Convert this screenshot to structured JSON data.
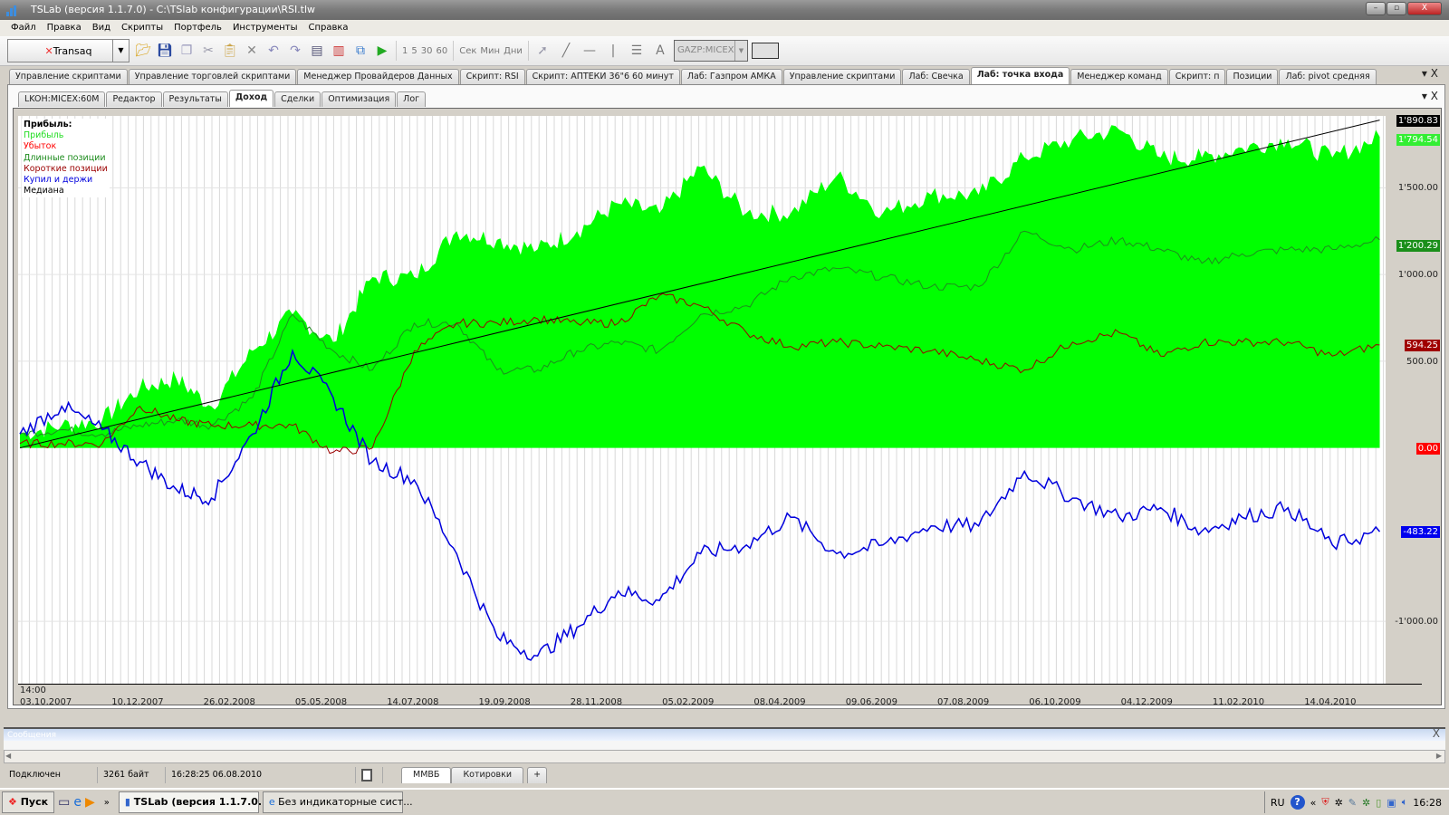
{
  "window": {
    "title": "TSLab (версия 1.1.7.0) - C:\\TSlab конфигурации\\RSI.tlw",
    "minimize": "–",
    "maximize": "▫",
    "close": "X"
  },
  "menu": [
    "Файл",
    "Правка",
    "Вид",
    "Скрипты",
    "Портфель",
    "Инструменты",
    "Справка"
  ],
  "toolbar": {
    "provider": "Transaq",
    "timeframes": [
      "1",
      "5",
      "30",
      "60"
    ],
    "units": [
      "Сек",
      "Мин",
      "Дни"
    ],
    "symbol": "GAZP:MICEX",
    "icons": [
      "open-folder-icon",
      "save-icon",
      "copy-icon",
      "cut-icon",
      "paste-icon",
      "delete-icon",
      "undo-icon",
      "redo-icon",
      "properties-icon",
      "chart-icon",
      "diagram-icon",
      "run-icon"
    ]
  },
  "main_tabs": [
    "Управление скриптами",
    "Управление торговлей скриптами",
    "Менеджер Провайдеров Данных",
    "Скрипт: RSI",
    "Скрипт: АПТЕКИ 36\"6 60 минут",
    "Лаб: Газпром АМКА",
    "Управление скриптами",
    "Лаб: Свечка",
    "Лаб: точка входа",
    "Менеджер команд",
    "Скрипт: п",
    "Позиции",
    "Лаб: pivot средняя"
  ],
  "main_tabs_active": 8,
  "sub_tabs": [
    "LKOH:MICEX:60M",
    "Редактор",
    "Результаты",
    "Доход",
    "Сделки",
    "Оптимизация",
    "Лог"
  ],
  "sub_tabs_active": 3,
  "tab_controls": {
    "menu": "▾",
    "close": "X"
  },
  "chart_data": {
    "type": "area",
    "legend_title": "Прибыль:",
    "legend_placement": "top-left",
    "grid": true,
    "ylim": [
      -1360,
      1915
    ],
    "yticks": [
      {
        "value": 1500,
        "label": "1'500.00"
      },
      {
        "value": 1000,
        "label": "1'000.00"
      },
      {
        "value": 500,
        "label": "500.00"
      },
      {
        "value": -1000,
        "label": "-1'000.00"
      }
    ],
    "xticks": [
      {
        "date": "2007-10-03",
        "label": "03.10.2007",
        "sublabel": "14:00"
      },
      {
        "date": "2007-12-10",
        "label": "10.12.2007"
      },
      {
        "date": "2008-02-26",
        "label": "26.02.2008"
      },
      {
        "date": "2008-05-05",
        "label": "05.05.2008"
      },
      {
        "date": "2008-07-14",
        "label": "14.07.2008"
      },
      {
        "date": "2008-09-19",
        "label": "19.09.2008"
      },
      {
        "date": "2008-11-28",
        "label": "28.11.2008"
      },
      {
        "date": "2009-02-05",
        "label": "05.02.2009"
      },
      {
        "date": "2009-04-08",
        "label": "08.04.2009"
      },
      {
        "date": "2009-06-09",
        "label": "09.06.2009"
      },
      {
        "date": "2009-08-07",
        "label": "07.08.2009"
      },
      {
        "date": "2009-10-06",
        "label": "06.10.2009"
      },
      {
        "date": "2009-12-04",
        "label": "04.12.2009"
      },
      {
        "date": "2010-02-11",
        "label": "11.02.2010"
      },
      {
        "date": "2010-04-14",
        "label": "14.04.2010"
      }
    ],
    "x": [
      "2007-10-03",
      "2007-11-03",
      "2007-12-03",
      "2008-01-03",
      "2008-02-03",
      "2008-03-03",
      "2008-04-03",
      "2008-05-03",
      "2008-06-03",
      "2008-07-03",
      "2008-08-03",
      "2008-09-03",
      "2008-10-03",
      "2008-11-03",
      "2008-12-03",
      "2009-01-03",
      "2009-02-03",
      "2009-03-03",
      "2009-04-03",
      "2009-05-03",
      "2009-06-03",
      "2009-07-03",
      "2009-08-03",
      "2009-09-03",
      "2009-10-03",
      "2009-11-03",
      "2009-12-03",
      "2010-01-03",
      "2010-02-03",
      "2010-03-03",
      "2010-04-03",
      "2010-05-03",
      "2010-06-04"
    ],
    "series": [
      {
        "name": "Прибыль",
        "kind": "area",
        "color": "#00ff00",
        "last": "1'794.54",
        "label_bg": "#33ee33",
        "values": [
          80,
          130,
          160,
          345,
          400,
          240,
          560,
          770,
          610,
          985,
          985,
          1250,
          1200,
          1145,
          1250,
          1410,
          1355,
          1620,
          1355,
          1355,
          1570,
          1355,
          1460,
          1460,
          1675,
          1780,
          1835,
          1675,
          1675,
          1730,
          1780,
          1675,
          1794.54
        ]
      },
      {
        "name": "Убыток",
        "kind": "area",
        "color": "#ff0000",
        "last": "0.00",
        "label_bg": "#ff0000",
        "values": [
          0,
          0,
          0,
          0,
          0,
          0,
          0,
          0,
          0,
          0,
          0,
          0,
          0,
          0,
          0,
          0,
          0,
          0,
          0,
          0,
          0,
          0,
          0,
          0,
          0,
          0,
          0,
          0,
          0,
          0,
          0,
          0,
          0
        ]
      },
      {
        "name": "Длинные позиции",
        "kind": "line",
        "color": "#1e8c1e",
        "last": "1'200.29",
        "label_bg": "#1a8f1a",
        "values": [
          80,
          105,
          80,
          130,
          160,
          130,
          290,
          770,
          560,
          450,
          720,
          720,
          450,
          450,
          560,
          610,
          560,
          770,
          820,
          985,
          1035,
          985,
          930,
          930,
          1250,
          1145,
          1200,
          1145,
          1065,
          1120,
          1145,
          1145,
          1200.29
        ]
      },
      {
        "name": "Короткие позиции",
        "kind": "line",
        "color": "#9b0000",
        "last": "594.25",
        "label_bg": "#a00000",
        "values": [
          25,
          25,
          25,
          240,
          160,
          130,
          130,
          130,
          -25,
          0,
          560,
          720,
          720,
          745,
          720,
          720,
          880,
          820,
          665,
          585,
          610,
          585,
          560,
          505,
          450,
          610,
          665,
          530,
          610,
          610,
          610,
          530,
          594.25
        ]
      },
      {
        "name": "Купил и держи",
        "kind": "line",
        "color": "#0000dd",
        "last": "-483.22",
        "label_bg": "#0000ee",
        "values": [
          80,
          240,
          105,
          -80,
          -240,
          -290,
          80,
          560,
          290,
          -80,
          -185,
          -610,
          -1090,
          -1200,
          -1035,
          -825,
          -880,
          -610,
          -560,
          -400,
          -610,
          -560,
          -450,
          -450,
          -135,
          -290,
          -400,
          -345,
          -480,
          -400,
          -345,
          -560,
          -483.22
        ]
      },
      {
        "name": "Медиана",
        "kind": "line",
        "color": "#000000",
        "last": "1'890.83",
        "label_bg": "#000000",
        "values": [
          0,
          1890.83
        ],
        "x": [
          "2007-10-03",
          "2010-06-04"
        ]
      }
    ]
  },
  "messages": {
    "title": "Сообщения",
    "close": "X"
  },
  "status": {
    "connection": "Подключен",
    "bytes": "3261 байт",
    "datetime": "16:28:25 06.08.2010",
    "tabs": [
      "ММВБ",
      "Котировки"
    ],
    "add": "+"
  },
  "taskbar": {
    "start": "Пуск",
    "more": "»",
    "windows": [
      "TSLab (версия 1.1.7.0...",
      "Без индикаторные сист..."
    ],
    "lang": "RU",
    "clock": "16:28"
  }
}
